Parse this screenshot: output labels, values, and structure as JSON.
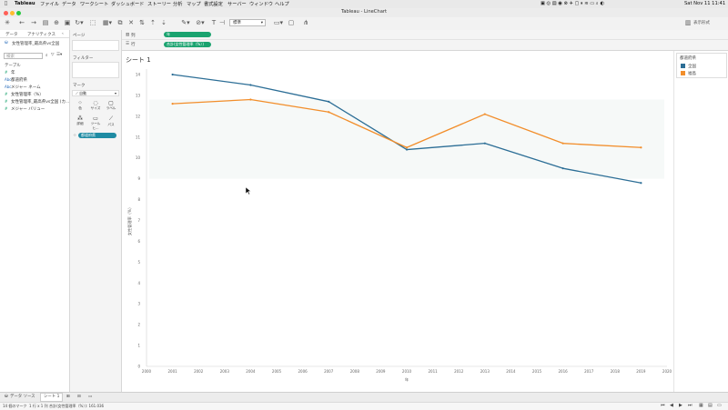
{
  "menubar": {
    "app_name": "Tableau",
    "items": [
      "ファイル",
      "データ",
      "ワークシート",
      "ダッシュボード",
      "ストーリー",
      "分析",
      "マップ",
      "書式設定",
      "サーバー",
      "ウィンドウ",
      "ヘルプ"
    ],
    "clock": "Sat Nov 11  11:41"
  },
  "window": {
    "title": "Tableau - LineChart"
  },
  "toolbar": {
    "show_me_label": "表示形式",
    "fit_select": "標準"
  },
  "leftpane": {
    "tab_data": "データ",
    "tab_analytics": "アナリティクス",
    "datasource": "女性管理率_最高県vs全国",
    "search_placeholder": "検索",
    "tables_header": "テーブル",
    "fields": [
      {
        "icon": "#",
        "name": "年",
        "color": "#1aa36f"
      },
      {
        "icon": "Abc",
        "name": "都道府県",
        "color": "#2a6ebb"
      },
      {
        "icon": "Abc",
        "name": "メジャー ネーム",
        "color": "#2a6ebb"
      },
      {
        "icon": "#",
        "name": "女性管理率（%）",
        "color": "#1aa36f"
      },
      {
        "icon": "#",
        "name": "女性管理率_最高県vs全国 (カ...",
        "color": "#1aa36f"
      },
      {
        "icon": "#",
        "name": "メジャー バリュー",
        "color": "#1aa36f"
      }
    ]
  },
  "cards": {
    "pages_title": "ページ",
    "filters_title": "フィルター",
    "marks_title": "マーク",
    "mark_type": "自動",
    "mark_buttons": [
      "色",
      "サイズ",
      "ラベル",
      "詳細",
      "ツールヒ...",
      "パス"
    ],
    "color_pill": "都道府県"
  },
  "shelves": {
    "columns_label": "列",
    "rows_label": "行",
    "columns_pill": "年",
    "rows_pill": "合計(女性管理率（%）)"
  },
  "sheet": {
    "title": "シート 1"
  },
  "legend": {
    "title": "都道府県",
    "items": [
      {
        "label": "全国",
        "color": "#2c6e96"
      },
      {
        "label": "福島",
        "color": "#f28e2b"
      }
    ]
  },
  "chart_data": {
    "type": "line",
    "xlabel": "年",
    "ylabel": "女性管理率（%）",
    "xlim": [
      2000,
      2020
    ],
    "ylim": [
      0,
      14
    ],
    "x_ticks": [
      2000,
      2001,
      2002,
      2003,
      2004,
      2005,
      2006,
      2007,
      2008,
      2009,
      2010,
      2011,
      2012,
      2013,
      2014,
      2015,
      2016,
      2017,
      2018,
      2019,
      2020
    ],
    "y_ticks": [
      0,
      1,
      2,
      3,
      4,
      5,
      6,
      7,
      8,
      9,
      10,
      11,
      12,
      13,
      14
    ],
    "grid": false,
    "legend_position": "right",
    "series": [
      {
        "name": "全国",
        "color": "#2c6e96",
        "x": [
          2001,
          2004,
          2007,
          2010,
          2013,
          2016,
          2019
        ],
        "values": [
          14.0,
          13.5,
          12.7,
          10.4,
          10.7,
          9.5,
          8.8
        ]
      },
      {
        "name": "福島",
        "color": "#f28e2b",
        "x": [
          2001,
          2004,
          2007,
          2010,
          2013,
          2016,
          2019
        ],
        "values": [
          12.6,
          12.8,
          12.2,
          10.5,
          12.1,
          10.7,
          10.5
        ]
      }
    ]
  },
  "bottombar": {
    "datasource_tab": "データ ソース",
    "sheet_tab": "シート 1"
  },
  "statusbar": {
    "marks_count": "14 個のマーク",
    "rows_cols": "1 行 x 1 列",
    "sum_text": "合計(女性管理率（%）): 161.036"
  }
}
